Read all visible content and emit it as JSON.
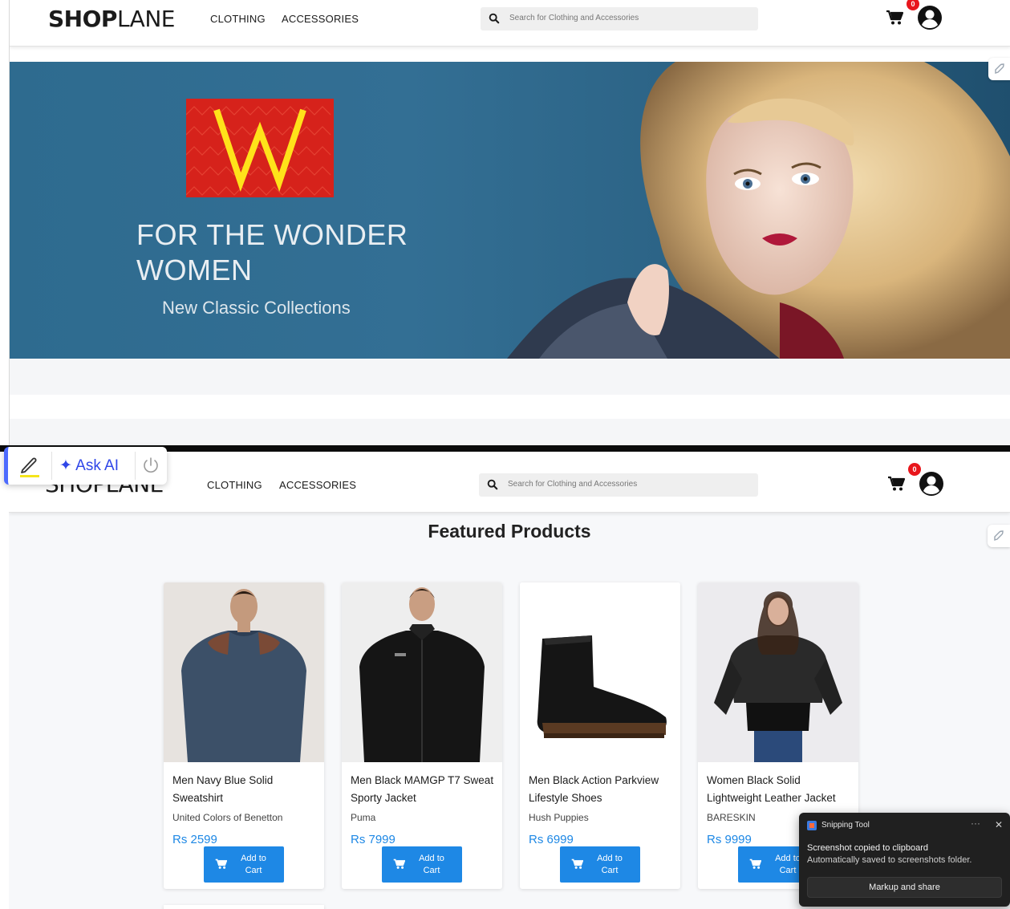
{
  "header": {
    "logo_bold": "SHOP",
    "logo_light": "LANE",
    "nav": [
      "CLOTHING",
      "ACCESSORIES"
    ],
    "search_placeholder": "Search for Clothing and Accessories",
    "cart_count": "0"
  },
  "header_bottom": {
    "logo_partial": "SHOPLANE"
  },
  "banner": {
    "logo_letter": "W",
    "title_line1": "FOR THE WONDER",
    "title_line2": "WOMEN",
    "subtitle": "New Classic Collections"
  },
  "featured": {
    "title": "Featured Products",
    "products": [
      {
        "name": "Men Navy Blue Solid Sweatshirt",
        "brand": "United Colors of Benetton",
        "price": "Rs 2599",
        "button": "Add to Cart"
      },
      {
        "name": "Men Black MAMGP T7 Sweat Sporty Jacket",
        "brand": "Puma",
        "price": "Rs 7999",
        "button": "Add to Cart"
      },
      {
        "name": "Men Black Action Parkview Lifestyle Shoes",
        "brand": "Hush Puppies",
        "price": "Rs 6999",
        "button": "Add to Cart"
      },
      {
        "name": "Women Black Solid Lightweight Leather Jacket",
        "brand": "BARESKIN",
        "price": "Rs 9999",
        "button": "Add to Cart"
      }
    ]
  },
  "toolbar": {
    "ask_ai": "✦ Ask AI"
  },
  "toast": {
    "app_name": "Snipping Tool",
    "dots": "···",
    "close": "✕",
    "line1": "Screenshot copied to clipboard",
    "line2": "Automatically saved to screenshots folder.",
    "button": "Markup and share"
  },
  "colors": {
    "accent": "#1e88e5",
    "badge": "#e8161c",
    "banner_bg": "#336f94",
    "w_logo": "#d6221b",
    "ask_ai": "#2f46e8"
  }
}
